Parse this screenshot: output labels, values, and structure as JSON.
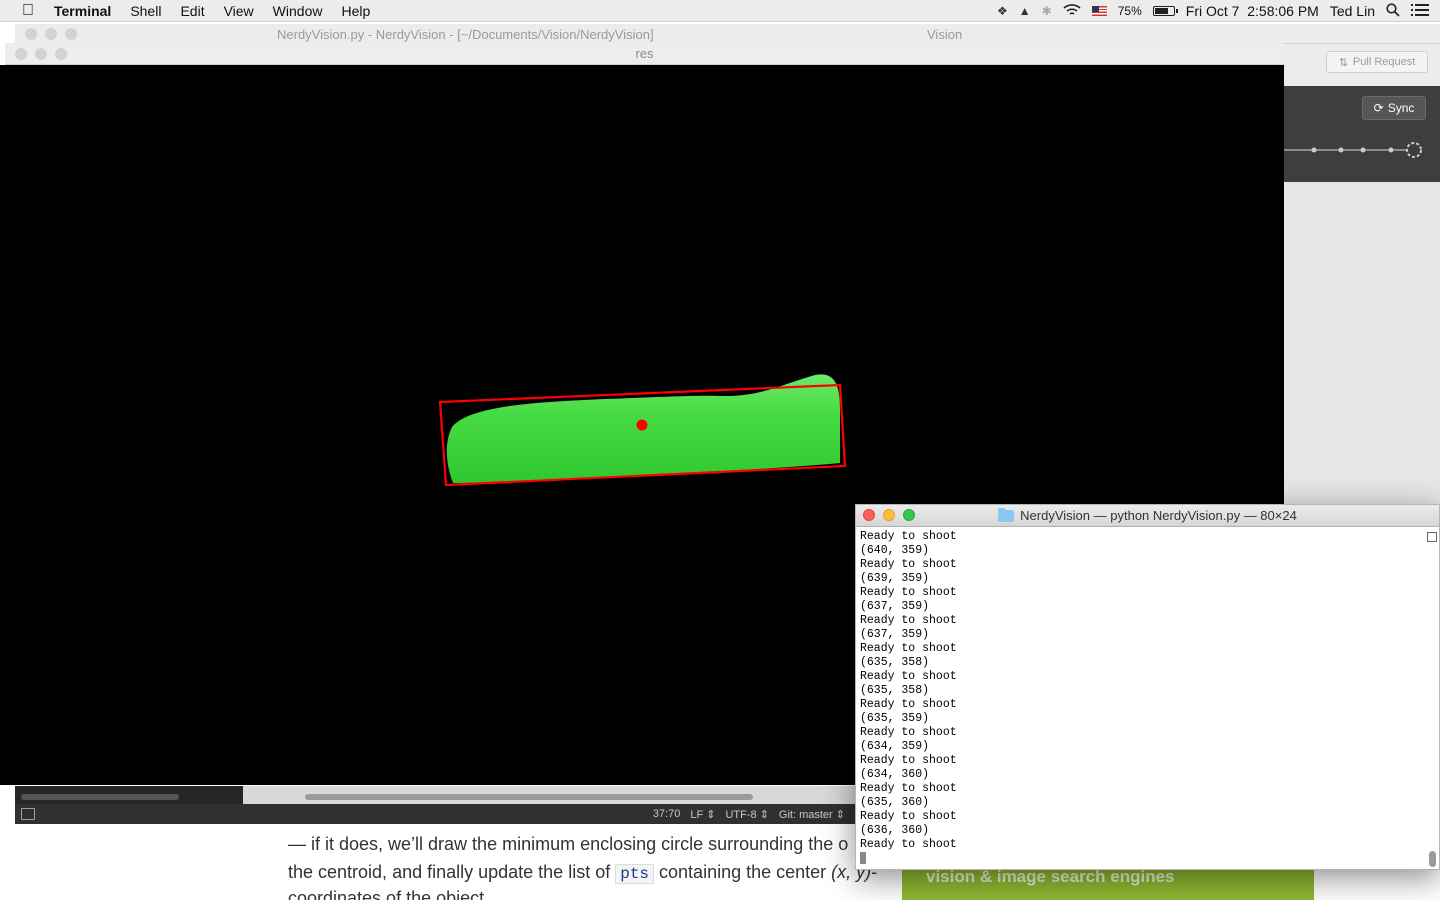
{
  "menubar": {
    "app_name": "Terminal",
    "items": [
      "Shell",
      "Edit",
      "View",
      "Window",
      "Help"
    ],
    "battery_percent": "75%",
    "battery_level": 0.75,
    "datetime": "Fri Oct 7  2:58:06 PM",
    "user": "Ted Lin"
  },
  "editor": {
    "title": "NerdyVision.py - NerdyVision - [~/Documents/Vision/NerdyVision]",
    "title_overflow": "Vision",
    "status": {
      "cursor": "37:70",
      "line_ending": "LF",
      "encoding": "UTF-8",
      "git": "Git: master"
    }
  },
  "github": {
    "pull_request_label": "Pull Request",
    "sync_label": "Sync"
  },
  "res_window": {
    "title": "res",
    "detection": {
      "box_color": "#ff0000",
      "blob_color": "#3bd63b",
      "center_color": "#ff0000"
    }
  },
  "terminal": {
    "title": "NerdyVision — python NerdyVision.py — 80×24",
    "lines": [
      "Ready to shoot",
      "(640, 359)",
      "Ready to shoot",
      "(639, 359)",
      "Ready to shoot",
      "(637, 359)",
      "Ready to shoot",
      "(637, 359)",
      "Ready to shoot",
      "(635, 358)",
      "Ready to shoot",
      "(635, 358)",
      "Ready to shoot",
      "(635, 359)",
      "Ready to shoot",
      "(634, 359)",
      "Ready to shoot",
      "(634, 360)",
      "Ready to shoot",
      "(635, 360)",
      "Ready to shoot",
      "(636, 360)",
      "Ready to shoot"
    ]
  },
  "article": {
    "line1": "— if it does, we’ll draw the minimum enclosing circle surrounding the o",
    "line2_before": "the centroid, and finally update the list of ",
    "line2_code": "pts",
    "line2_after": " containing the center ",
    "line2_em": "(x, y)",
    "line2_end": "-",
    "line3": "coordinates of the object.",
    "ad_text": "vision & image search engines"
  }
}
